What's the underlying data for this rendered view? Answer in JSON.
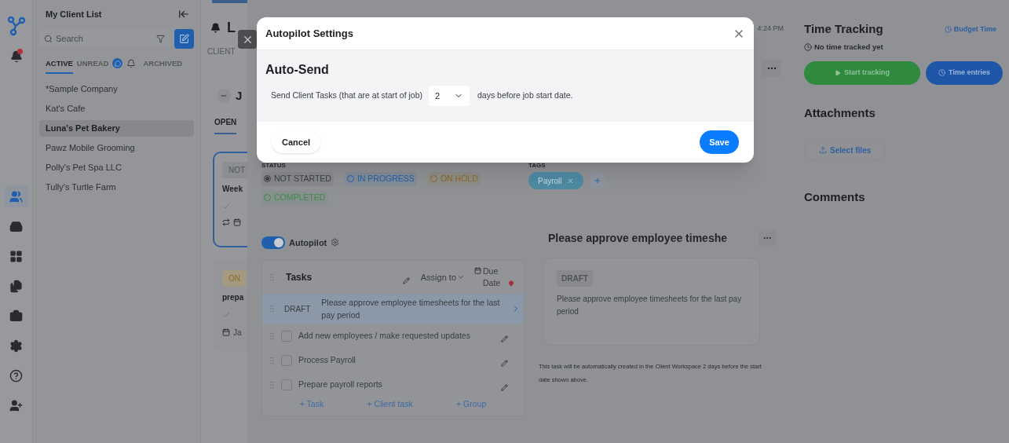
{
  "nav": [
    {
      "selected": true
    },
    {
      "selected": false
    },
    {
      "selected": false
    },
    {
      "selected": false
    },
    {
      "selected": false
    },
    {
      "selected": false
    },
    {
      "selected": false
    },
    {
      "selected": false
    }
  ],
  "client_list": {
    "title": "My Client List",
    "search": {
      "placeholder": "Search"
    },
    "tabs": [
      {
        "label": "ACTIVE",
        "selected": true
      },
      {
        "label": "UNREAD",
        "selected": false
      },
      {
        "label": "ARCHIVED",
        "selected": false
      }
    ],
    "clients": [
      {
        "name": "*Sample Company",
        "selected": false
      },
      {
        "name": "Kat's Cafe",
        "selected": false
      },
      {
        "name": "Luna's Pet Bakery",
        "selected": true
      },
      {
        "name": "Pawz Mobile Grooming",
        "selected": false
      },
      {
        "name": "Polly's Pet Spa LLC",
        "selected": false
      },
      {
        "name": "Tully's Turtle Farm",
        "selected": false
      }
    ]
  },
  "jobs": {
    "initial": "L",
    "client_tab": "CLIENT",
    "section": "J",
    "open_tab": "OPEN",
    "cards": [
      {
        "badge": "NOT",
        "title": "Week",
        "selected": true,
        "kind": "recurring"
      },
      {
        "badge": "ON",
        "title": "prepa",
        "selected": false,
        "kind": "dated",
        "date": "Ja"
      }
    ]
  },
  "detail": {
    "time": "4:24 PM",
    "status_label": "STATUS",
    "statuses": [
      {
        "label": "NOT STARTED",
        "selected": true,
        "color": "#3d3f43"
      },
      {
        "label": "IN PROGRESS",
        "selected": false,
        "color": "#1f5fae"
      },
      {
        "label": "ON HOLD",
        "selected": false,
        "color": "#8c6a1c"
      },
      {
        "label": "COMPLETED",
        "selected": false,
        "color": "#3f8a4a"
      }
    ],
    "tags_label": "TAGS",
    "tags": [
      {
        "label": "Payroll"
      }
    ],
    "autopilot": {
      "label": "Autopilot",
      "on": true
    },
    "tasks": {
      "title": "Tasks",
      "assign": "Assign to",
      "due": "Due Date",
      "rows": [
        {
          "kind": "draft",
          "badge": "DRAFT",
          "text": "Please approve employee timesheets for the last pay period",
          "selected": true
        },
        {
          "kind": "task",
          "text": "Add new employees / make requested updates",
          "checked": false
        },
        {
          "kind": "task",
          "text": "Process Payroll",
          "checked": false
        },
        {
          "kind": "task",
          "text": "Prepare payroll reports",
          "checked": false
        }
      ],
      "add_buttons": [
        "+ Task",
        "+ Client task",
        "+ Group"
      ]
    },
    "preview": {
      "title": "Please approve employee timeshe",
      "badge": "DRAFT",
      "text": "Please approve employee timesheets for the last pay period",
      "note": "This task will be automatically created in the Client Workspace 2 days before the start date shown above."
    }
  },
  "right": {
    "time_title": "Time Tracking",
    "budget": "Budget Time",
    "status": "No time tracked yet",
    "start": "Start tracking",
    "entries": "Time entries",
    "attachments": "Attachments",
    "select": "Select files",
    "comments": "Comments"
  },
  "modal": {
    "title": "Autopilot Settings",
    "heading": "Auto-Send",
    "prefix": "Send Client Tasks (that are at start of job)",
    "days": "2",
    "suffix": "days before job start date.",
    "cancel": "Cancel",
    "save": "Save"
  }
}
